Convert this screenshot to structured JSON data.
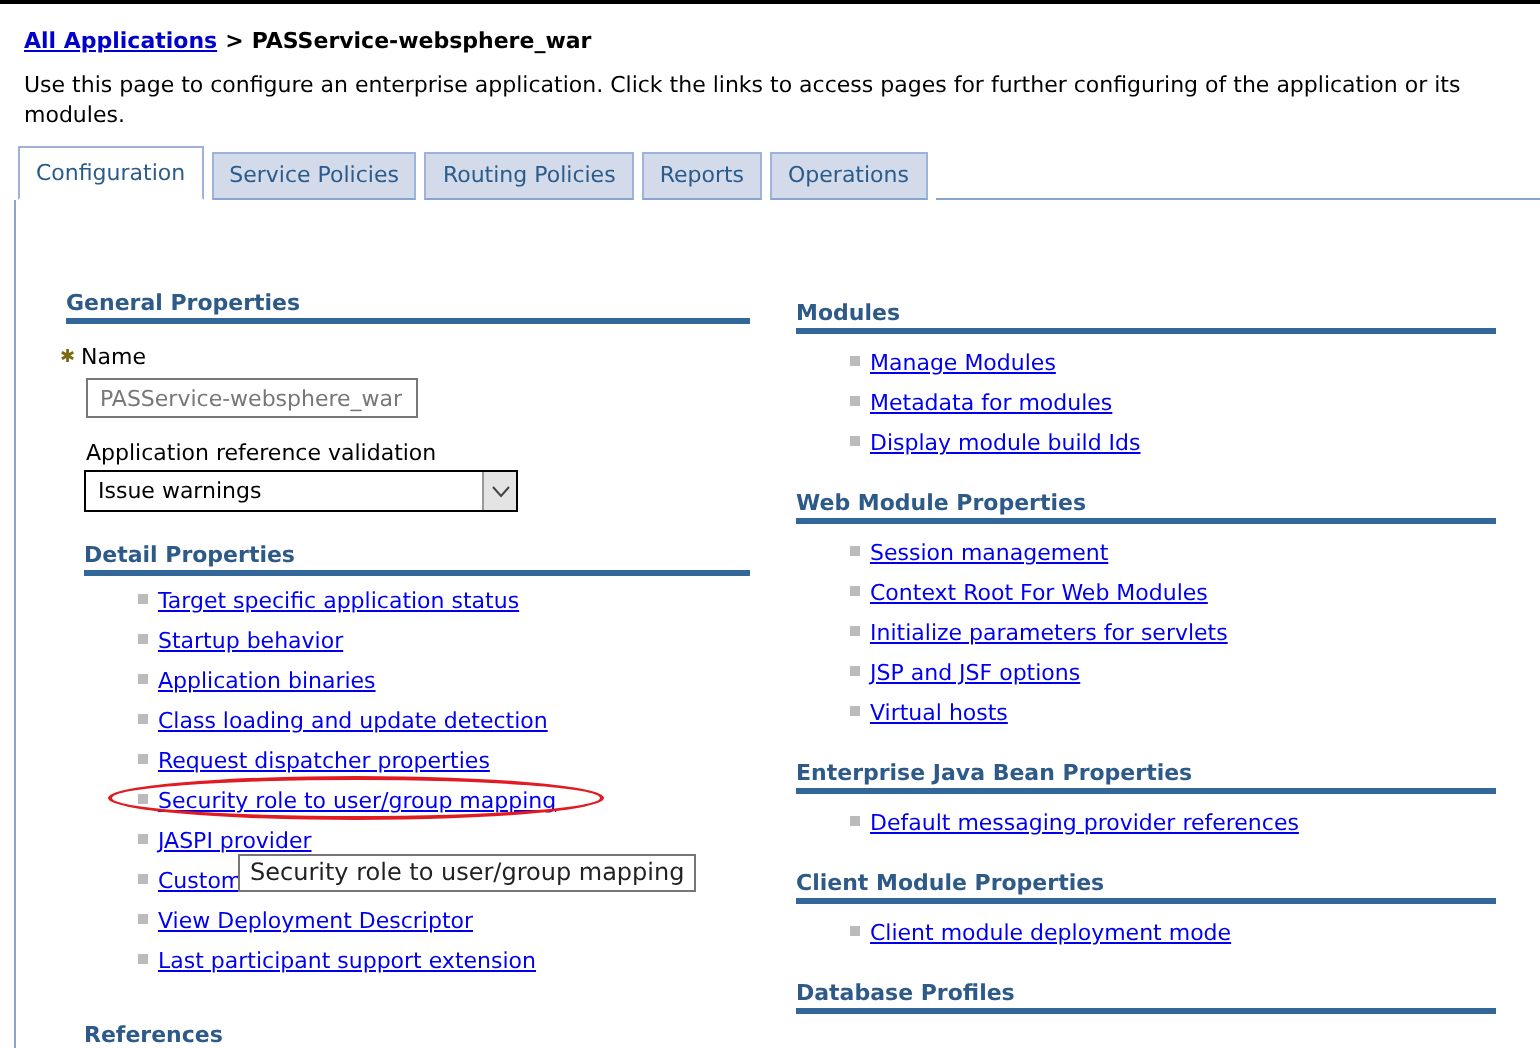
{
  "breadcrumb": {
    "link": "All Applications",
    "separator": ">",
    "current": "PASService-websphere_war"
  },
  "description": "Use this page to configure an enterprise application. Click the links to access pages for further configuring of the application or its modules.",
  "tabs": [
    {
      "label": "Configuration",
      "selected": true
    },
    {
      "label": "Service Policies",
      "selected": false
    },
    {
      "label": "Routing Policies",
      "selected": false
    },
    {
      "label": "Reports",
      "selected": false
    },
    {
      "label": "Operations",
      "selected": false
    }
  ],
  "general_properties": {
    "title": "General Properties",
    "name_label": "Name",
    "required_mark": "✱",
    "name_value": "PASService-websphere_war",
    "name_disabled": true,
    "validation_label": "Application reference validation",
    "validation_value": "Issue warnings"
  },
  "detail_properties": {
    "title": "Detail Properties",
    "links": [
      {
        "label": "Target specific application status",
        "highlighted": false
      },
      {
        "label": "Startup behavior",
        "highlighted": false
      },
      {
        "label": "Application binaries",
        "highlighted": false
      },
      {
        "label": "Class loading and update detection",
        "highlighted": false
      },
      {
        "label": "Request dispatcher properties",
        "highlighted": false
      },
      {
        "label": "Security role to user/group mapping",
        "highlighted": true
      },
      {
        "label": "JASPI provider",
        "highlighted": false
      },
      {
        "label": "Custom",
        "highlighted": false,
        "tooltip": "Security role to user/group mapping"
      },
      {
        "label": "View Deployment Descriptor",
        "highlighted": false
      },
      {
        "label": "Last participant support extension",
        "highlighted": false
      }
    ]
  },
  "references": {
    "title": "References"
  },
  "right_sections": [
    {
      "title": "Modules",
      "links": [
        "Manage Modules",
        "Metadata for modules",
        "Display module build Ids"
      ]
    },
    {
      "title": "Web Module Properties",
      "links": [
        "Session management",
        "Context Root For Web Modules",
        "Initialize parameters for servlets",
        "JSP and JSF options",
        "Virtual hosts"
      ]
    },
    {
      "title": "Enterprise Java Bean Properties",
      "links": [
        "Default messaging provider references"
      ]
    },
    {
      "title": "Client Module Properties",
      "links": [
        "Client module deployment mode"
      ]
    },
    {
      "title": "Database Profiles"
    }
  ]
}
